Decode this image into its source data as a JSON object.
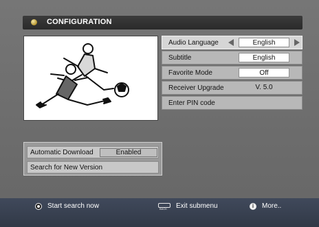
{
  "title": "CONFIGURATION",
  "menu": {
    "rows": [
      {
        "label": "Audio Language",
        "value": "English"
      },
      {
        "label": "Subtitle",
        "value": "English"
      },
      {
        "label": "Favorite Mode",
        "value": "Off"
      },
      {
        "label": "Receiver Upgrade",
        "value": "V. 5.0"
      },
      {
        "label": "Enter PIN code",
        "value": ""
      }
    ]
  },
  "firmware": {
    "automatic_download_label": "Automatic Download",
    "automatic_download_value": "Enabled",
    "search_new_version_label": "Search for New Version"
  },
  "footer": {
    "start_search": "Start search now",
    "exit_submenu": "Exit submenu",
    "more": "More.."
  },
  "icons": {
    "title": "disc-icon",
    "start": "record-icon",
    "back": "back-icon",
    "info": "info-icon"
  }
}
